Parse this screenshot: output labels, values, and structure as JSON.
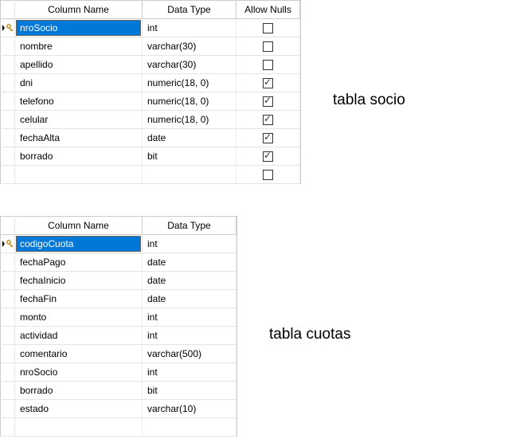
{
  "headers": {
    "columnName": "Column Name",
    "dataType": "Data Type",
    "allowNulls": "Allow Nulls"
  },
  "captions": {
    "socio": "tabla socio",
    "cuotas": "tabla cuotas"
  },
  "socio": {
    "rows": [
      {
        "name": "nroSocio",
        "type": "int",
        "nulls": false,
        "pk": true,
        "selected": true
      },
      {
        "name": "nombre",
        "type": "varchar(30)",
        "nulls": false
      },
      {
        "name": "apellido",
        "type": "varchar(30)",
        "nulls": false
      },
      {
        "name": "dni",
        "type": "numeric(18, 0)",
        "nulls": true
      },
      {
        "name": "telefono",
        "type": "numeric(18, 0)",
        "nulls": true
      },
      {
        "name": "celular",
        "type": "numeric(18, 0)",
        "nulls": true
      },
      {
        "name": "fechaAlta",
        "type": "date",
        "nulls": true
      },
      {
        "name": "borrado",
        "type": "bit",
        "nulls": true
      },
      {
        "name": "",
        "type": "",
        "nulls": false,
        "blank": true
      }
    ]
  },
  "cuotas": {
    "rows": [
      {
        "name": "codigoCuota",
        "type": "int",
        "pk": true,
        "selected": true
      },
      {
        "name": "fechaPago",
        "type": "date"
      },
      {
        "name": "fechaInicio",
        "type": "date"
      },
      {
        "name": "fechaFin",
        "type": "date"
      },
      {
        "name": "monto",
        "type": "int"
      },
      {
        "name": "actividad",
        "type": "int"
      },
      {
        "name": "comentario",
        "type": "varchar(500)"
      },
      {
        "name": "nroSocio",
        "type": "int"
      },
      {
        "name": "borrado",
        "type": "bit"
      },
      {
        "name": "estado",
        "type": "varchar(10)"
      },
      {
        "name": "",
        "type": "",
        "blank": true
      }
    ]
  }
}
